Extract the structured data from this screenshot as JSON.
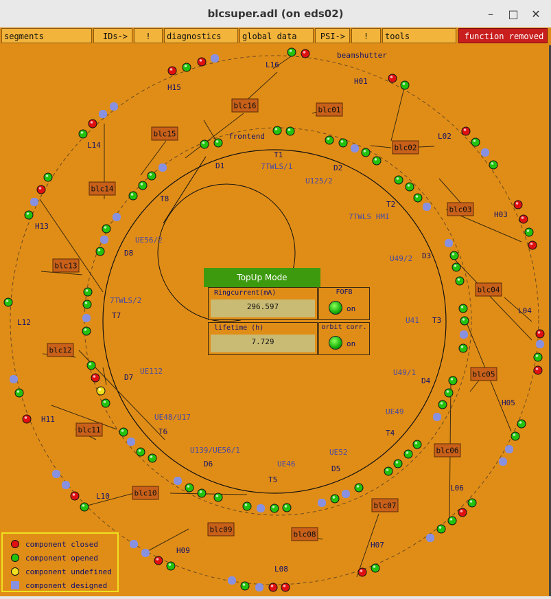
{
  "window": {
    "title": "blcsuper.adl (on eds02)",
    "controls": [
      "–",
      "□",
      "✕"
    ]
  },
  "menu": {
    "segments": "segments",
    "ids": "IDs->",
    "ids_flag": "!",
    "diagnostics": "diagnostics",
    "global_data": "global data",
    "psi": "PSI->",
    "psi_flag": "!",
    "tools": "tools",
    "function_removed": "function removed"
  },
  "ring": {
    "beamshutter": "beamshutter",
    "frontend": "frontend",
    "blc_labels": [
      "blc01",
      "blc02",
      "blc03",
      "blc04",
      "blc05",
      "blc06",
      "blc07",
      "blc08",
      "blc09",
      "blc10",
      "blc11",
      "blc12",
      "blc13",
      "blc14",
      "blc15",
      "blc16"
    ],
    "section_labels": [
      "H01",
      "L02",
      "H03",
      "L04",
      "H05",
      "L06",
      "H07",
      "L08",
      "H09",
      "L10",
      "H11",
      "L12",
      "H13",
      "L14",
      "H15",
      "L16"
    ],
    "inner_labels": [
      "T1",
      "D2",
      "T2",
      "D3",
      "T3",
      "D4",
      "T4",
      "D5",
      "T5",
      "D6",
      "T6",
      "D7",
      "T7",
      "D8",
      "T8",
      "D1"
    ],
    "undulators": [
      "7TWLS/1",
      "U125/2",
      "7TWLS HMI",
      "U49/2",
      "U41",
      "U49/1",
      "UE49",
      "UE52",
      "UE46",
      "U139/UE56/1",
      "UE48/U17",
      "UE112",
      "7TWLS/2",
      "UE56/2"
    ]
  },
  "topup": {
    "label": "TopUp Mode"
  },
  "ringcurrent": {
    "label": "Ringcurrent(mA)",
    "value": "296.597"
  },
  "lifetime": {
    "label": "lifetime (h)",
    "value": "7.729"
  },
  "fofb": {
    "label": "FOFB",
    "state": "on"
  },
  "orbit": {
    "label": "orbit corr.",
    "state": "on"
  },
  "legend": {
    "closed": "component closed",
    "opened": "component opened",
    "undefined": "component undefined",
    "designed": "component designed",
    "colors": {
      "closed": "#e01010",
      "opened": "#22c20e",
      "undefined": "#f0e020",
      "designed": "#8890e0"
    }
  }
}
